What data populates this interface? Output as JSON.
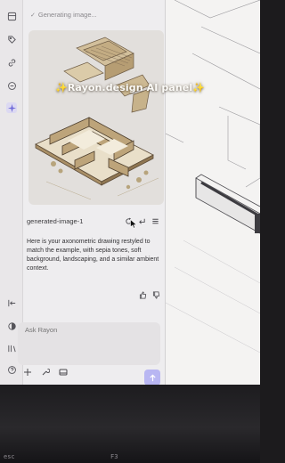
{
  "overlay": {
    "title": "Rayon.design AI panel",
    "sparkle": "✨"
  },
  "chat": {
    "status": "Generating image...",
    "image_name": "generated-image-1",
    "reply": "Here is your axonometric drawing restyled to match the example, with sepia tones, soft background, landscaping, and a similar ambient context.",
    "composer_placeholder": "Ask Rayon"
  },
  "rail_icons": [
    "layers-icon",
    "tag-icon",
    "link-icon",
    "comment-icon",
    "ai-sparkle-icon"
  ],
  "colors": {
    "accent": "#b8b6f2",
    "panel": "#eeedef",
    "sepia": "#c9b48f"
  },
  "keyboard": {
    "left": "esc",
    "mid": "F3"
  }
}
